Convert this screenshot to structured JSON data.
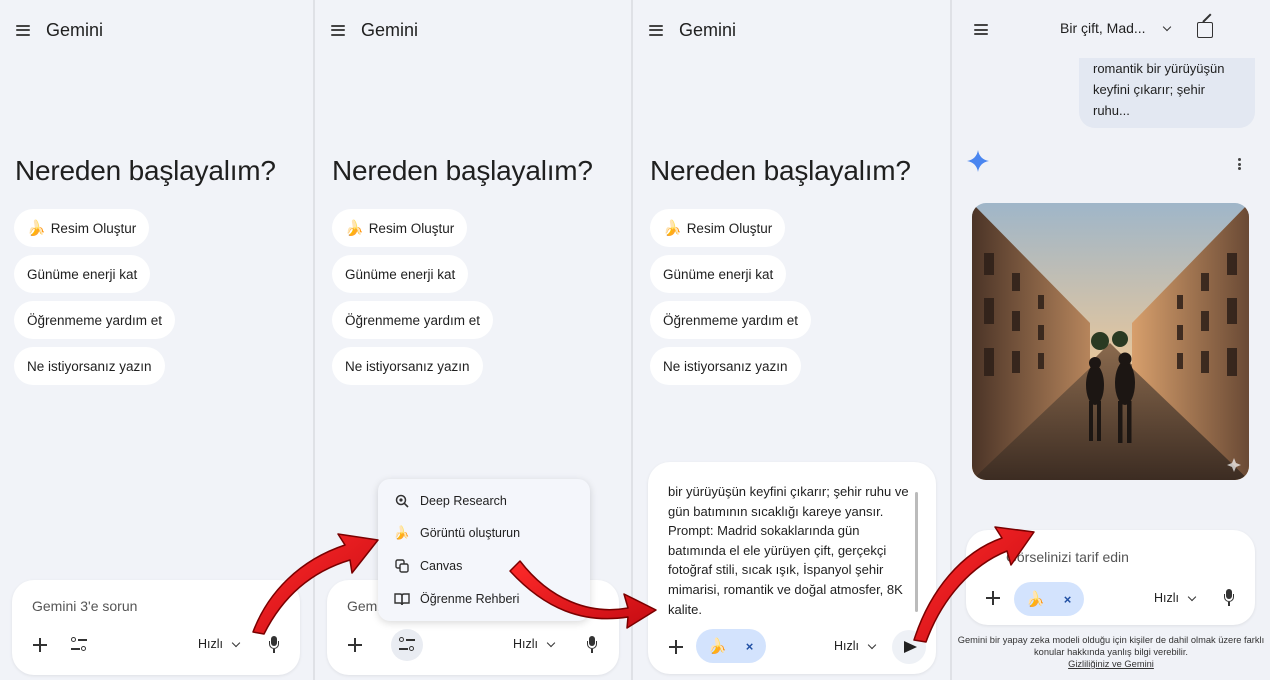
{
  "app": {
    "brand": "Gemini"
  },
  "home": {
    "greeting": "Nereden başlayalım?",
    "chips": [
      {
        "label": "Resim Oluştur",
        "icon": "banana-icon"
      },
      {
        "label": "Günüme enerji kat"
      },
      {
        "label": "Öğrenmeme yardım et"
      },
      {
        "label": "Ne istiyorsanız yazın"
      }
    ]
  },
  "composer": {
    "placeholder": "Gemini 3'e sorun",
    "placeholder_partial": "Gemi",
    "speed_label": "Hızlı",
    "icons": [
      "plus-icon",
      "tools-icon",
      "chevron-down-icon",
      "mic-icon"
    ]
  },
  "tools_menu": {
    "items": [
      {
        "label": "Deep Research",
        "icon": "deep-research-icon"
      },
      {
        "label": "Görüntü oluşturun",
        "icon": "banana-icon"
      },
      {
        "label": "Canvas",
        "icon": "canvas-icon"
      },
      {
        "label": "Öğrenme Rehberi",
        "icon": "book-icon"
      }
    ]
  },
  "prompt": {
    "text": "bir yürüyüşün keyfini çıkarır; şehir ruhu ve gün batımının sıcaklığı kareye yansır. Prompt: Madrid sokaklarında gün batımında el ele yürüyen çift, gerçekçi fotoğraf stili, sıcak ışık, İspanyol şehir mimarisi, romantik ve doğal atmosfer, 8K kalite.",
    "chip_remove": "×"
  },
  "result": {
    "chat_title": "Bir çift, Mad...",
    "user_message": "romantik bir yürüyüşün keyfini çıkarır; şehir ruhu...",
    "placeholder": "Görselinizi tarif edin",
    "disclaimer": "Gemini bir yapay zeka modeli olduğu için kişiler de dahil olmak üzere farklı konular hakkında yanlış bilgi verebilir.",
    "privacy_link": "Gizliliğiniz ve Gemini"
  },
  "colors": {
    "arrow": "#e8101a",
    "chip_blue": "#d3e3fd",
    "gemini_blue": "#4a86f0"
  }
}
